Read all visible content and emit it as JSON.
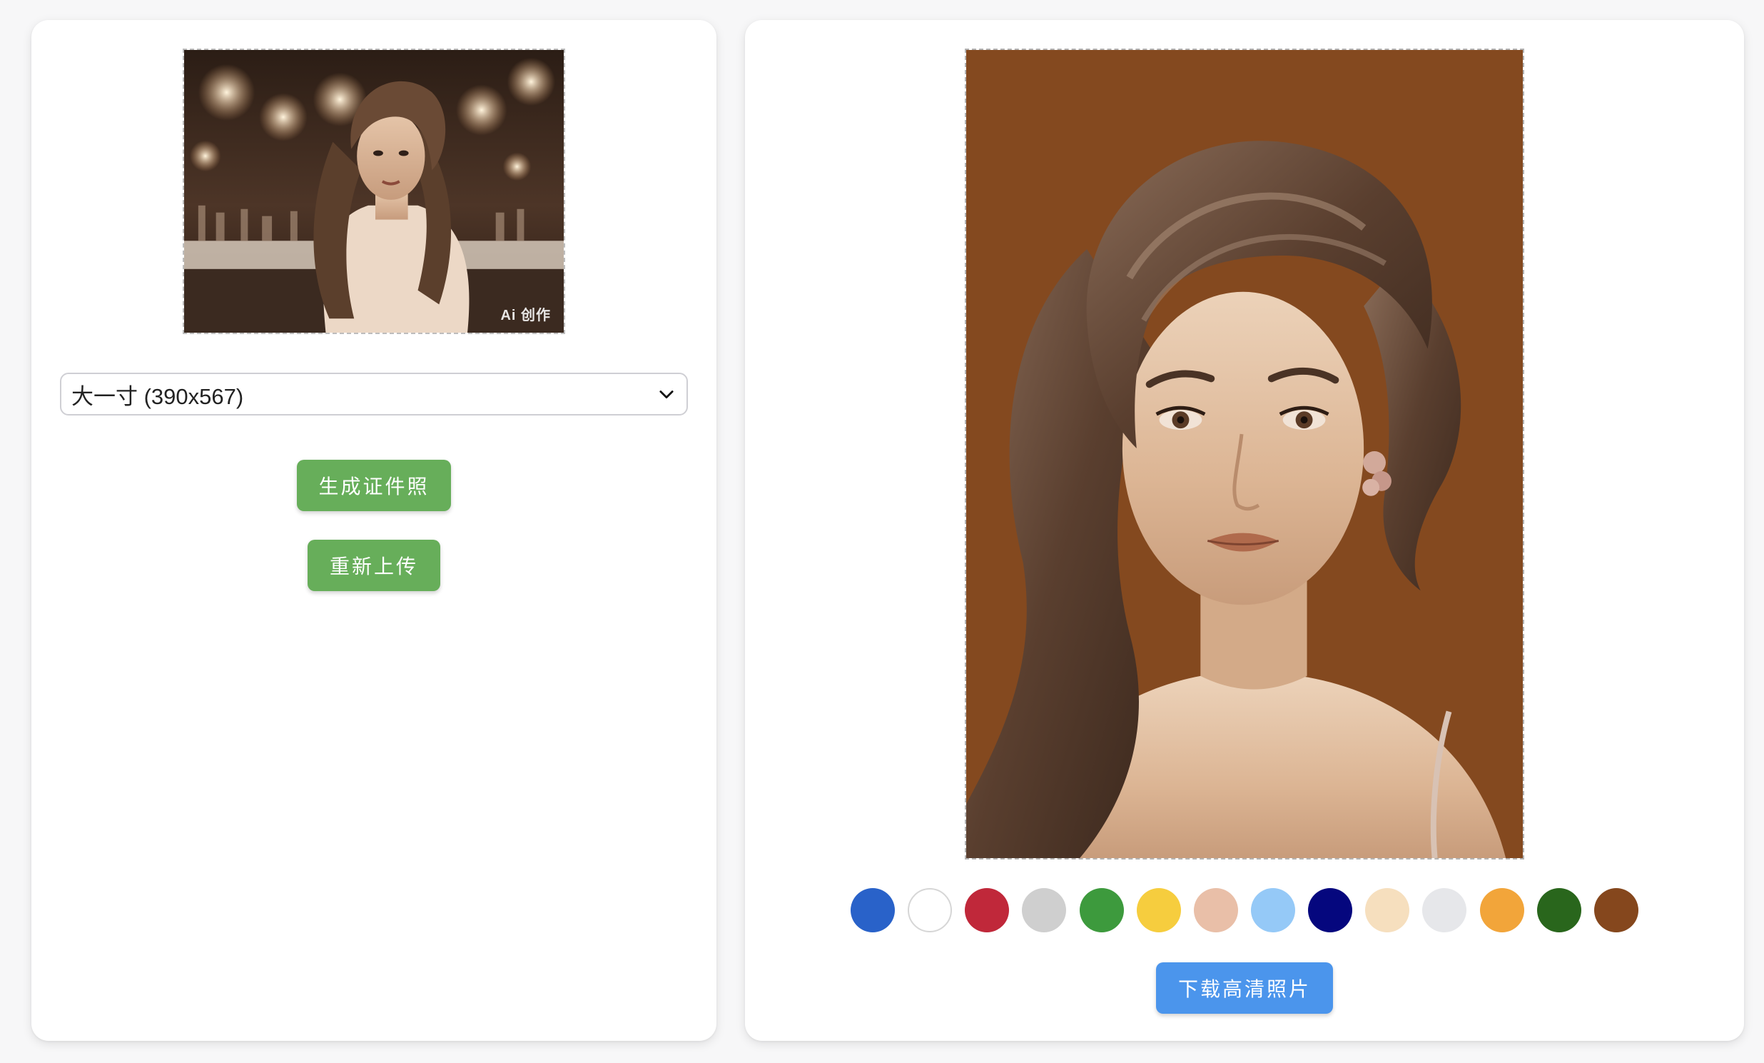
{
  "source_panel": {
    "watermark": "Ai 创作",
    "size_select": {
      "value": "大一寸 (390x567)",
      "icon": "chevron-down-icon"
    },
    "generate_button": "生成证件照",
    "reupload_button": "重新上传"
  },
  "result_panel": {
    "background_color": "#84491f",
    "swatches": [
      "#2962c9",
      "#ffffff",
      "#c0283a",
      "#cfcfcf",
      "#3d9a3d",
      "#f6cd3e",
      "#e9bfa8",
      "#95c9f7",
      "#05077e",
      "#f6dfbe",
      "#e6e7ea",
      "#f2a53a",
      "#29661c",
      "#85471d"
    ],
    "download_button": "下载高清照片"
  }
}
